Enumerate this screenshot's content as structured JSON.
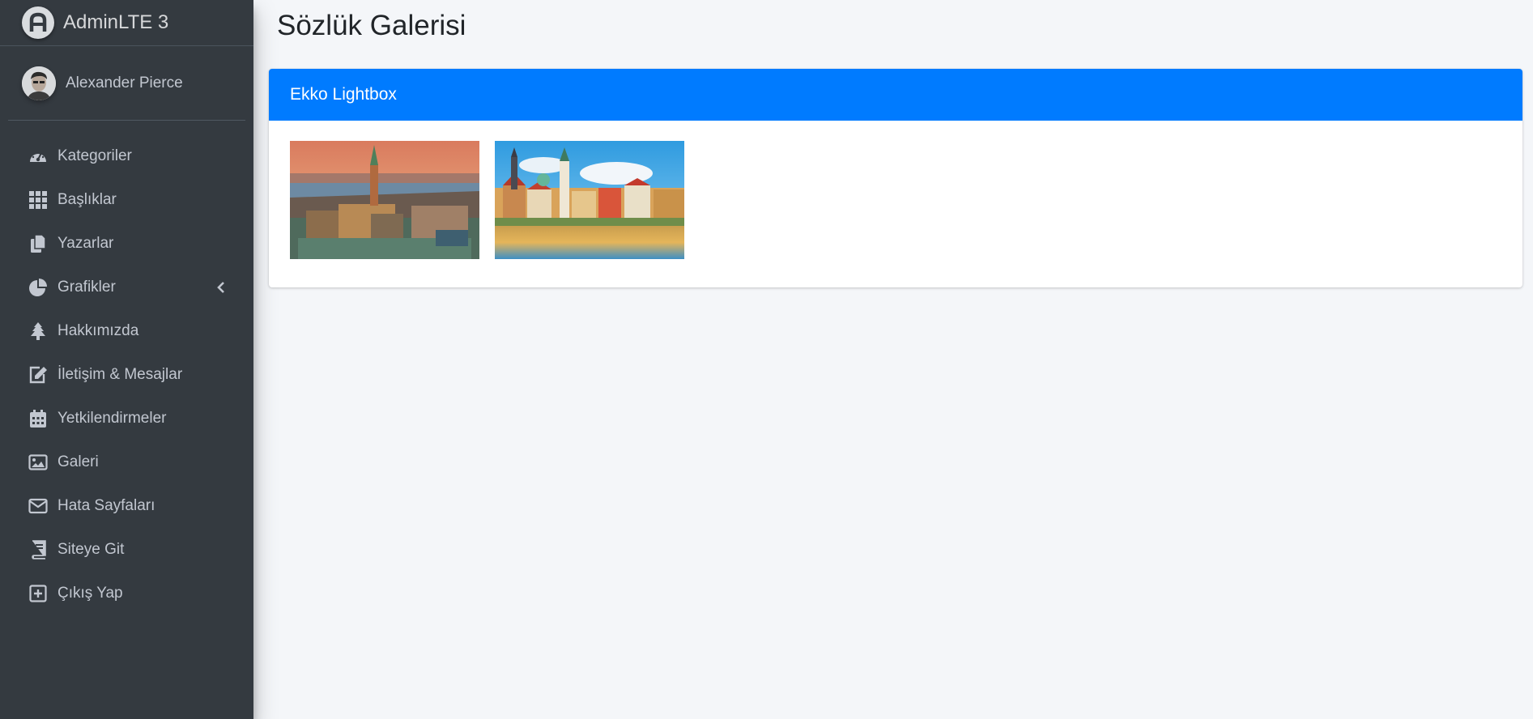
{
  "brand": {
    "text": "AdminLTE 3",
    "logo_icon": "adminlte-logo-icon"
  },
  "user": {
    "name": "Alexander Pierce",
    "avatar_icon": "user-avatar"
  },
  "sidebar": {
    "items": [
      {
        "label": "Kategoriler",
        "icon": "tachometer-icon"
      },
      {
        "label": "Başlıklar",
        "icon": "th-grid-icon"
      },
      {
        "label": "Yazarlar",
        "icon": "copy-icon"
      },
      {
        "label": "Grafikler",
        "icon": "pie-chart-icon",
        "has_submenu": true
      },
      {
        "label": "Hakkımızda",
        "icon": "tree-icon"
      },
      {
        "label": "İletişim & Mesajlar",
        "icon": "edit-icon"
      },
      {
        "label": "Yetkilendirmeler",
        "icon": "calendar-icon"
      },
      {
        "label": "Galeri",
        "icon": "image-icon"
      },
      {
        "label": "Hata Sayfaları",
        "icon": "envelope-icon"
      },
      {
        "label": "Siteye Git",
        "icon": "book-icon"
      },
      {
        "label": "Çıkış Yap",
        "icon": "plus-square-icon"
      }
    ]
  },
  "page": {
    "title": "Sözlük Galerisi"
  },
  "card": {
    "title": "Ekko Lightbox",
    "images": [
      {
        "subject": "city-hall-sunset-photo"
      },
      {
        "subject": "riverside-old-town-photo"
      }
    ]
  },
  "colors": {
    "sidebar_bg": "#343a40",
    "accent": "#007bff",
    "content_bg": "#f4f6f9",
    "nav_text": "#c2c7d0"
  }
}
